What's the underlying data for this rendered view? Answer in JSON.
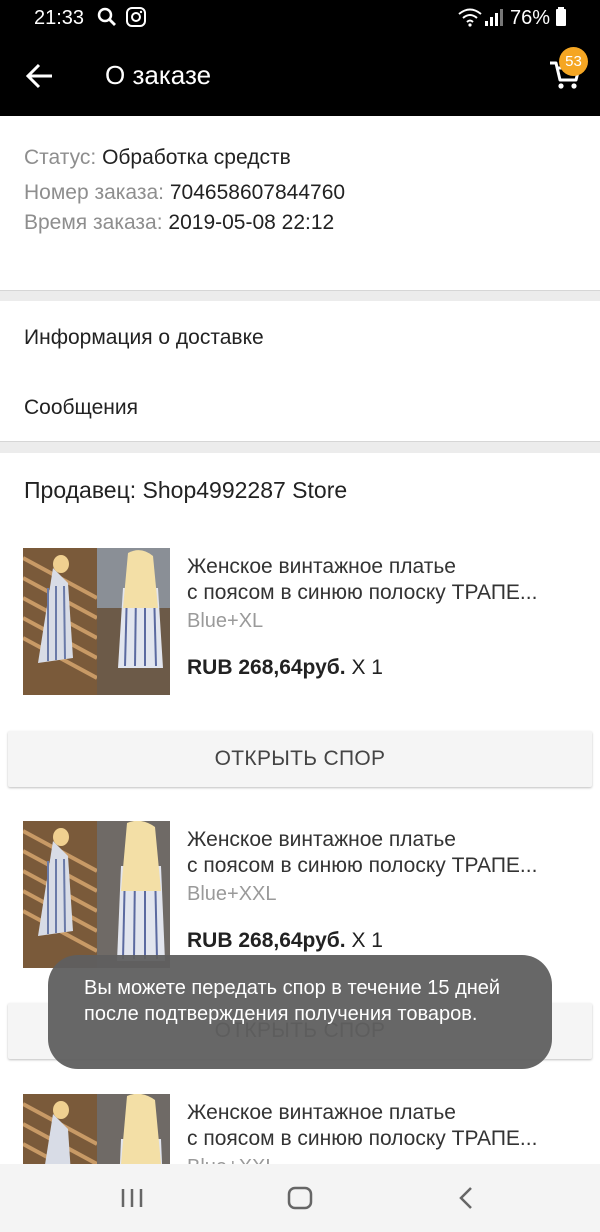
{
  "status_bar": {
    "time": "21:33",
    "battery": "76%"
  },
  "app_bar": {
    "title": "О заказе",
    "cart_count": "53"
  },
  "order": {
    "status_label": "Статус:",
    "status_value": "Обработка средств",
    "number_label": "Номер заказа:",
    "number_value": "704658607844760",
    "time_label": "Время заказа:",
    "time_value": "2019-05-08 22:12"
  },
  "menu": {
    "delivery": "Информация о доставке",
    "messages": "Сообщения"
  },
  "seller": "Продавец: Shop4992287 Store",
  "products": [
    {
      "name_line1": "Женское винтажное платье",
      "name_line2": "с поясом в синюю полоску ТРАПЕ...",
      "variant": "Blue+XL",
      "price": "RUB 268,64руб.",
      "qty": "X 1"
    },
    {
      "name_line1": "Женское винтажное платье",
      "name_line2": "с поясом в синюю полоску ТРАПЕ...",
      "variant": "Blue+XXL",
      "price": "RUB 268,64руб.",
      "qty": "X 1"
    },
    {
      "name_line1": "Женское винтажное платье",
      "name_line2": "с поясом в синюю полоску ТРАПЕ...",
      "variant": "Blue+XXL"
    }
  ],
  "dispute_button": "ОТКРЫТЬ СПОР",
  "toast": "Вы можете передать спор в течение 15 дней после подтверждения получения товаров.",
  "colors": {
    "badge": "#f5a623",
    "app_bar": "#000000",
    "toast_bg": "#5f5f5f"
  }
}
